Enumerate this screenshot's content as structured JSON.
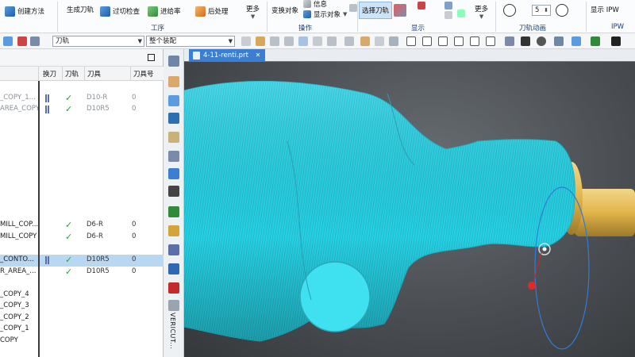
{
  "ribbon": {
    "buttons": {
      "create_method": "创建方法",
      "generate_toolpath": "生成刀轨",
      "gouge_check": "过切检查",
      "toolpath_from": "进给率",
      "post_process": "后处理",
      "transform_object": "变换对象",
      "info": "信息",
      "display_object": "显示对象",
      "select_toolpath": "选择刀轨",
      "display_ipw": "显示 IPW"
    },
    "more_label": "更多",
    "groups": {
      "process": "工序",
      "operation": "操作",
      "display": "显示",
      "toolpath_animation": "刀轨动画",
      "ipw": "IPW"
    },
    "animation_speed": "5"
  },
  "toolbar2": {
    "filter_combo": "刀轨",
    "assembly_combo": "整个装配"
  },
  "navigator": {
    "columns": {
      "tool_change": "换刀",
      "toolpath": "刀轨",
      "tool": "刀具",
      "tool_number": "刀具号"
    },
    "rows": [
      {
        "name": "",
        "tool": false,
        "check": false,
        "tool_name": "",
        "num": "",
        "dim": false,
        "selected": false
      },
      {
        "name": "_COPY_1...",
        "tool": true,
        "check": true,
        "tool_name": "D10-R",
        "num": "0",
        "dim": true,
        "selected": false
      },
      {
        "name": "AREA_COPY",
        "tool": true,
        "check": true,
        "tool_name": "D10R5",
        "num": "0",
        "dim": true,
        "selected": false
      },
      {
        "name": "",
        "tool": false,
        "check": false,
        "tool_name": "",
        "num": "",
        "dim": false,
        "selected": false
      },
      {
        "name": "",
        "tool": false,
        "check": false,
        "tool_name": "",
        "num": "",
        "dim": false,
        "selected": false
      },
      {
        "name": "",
        "tool": false,
        "check": false,
        "tool_name": "",
        "num": "",
        "dim": false,
        "selected": false
      },
      {
        "name": "",
        "tool": false,
        "check": false,
        "tool_name": "",
        "num": "",
        "dim": false,
        "selected": false
      },
      {
        "name": "",
        "tool": false,
        "check": false,
        "tool_name": "",
        "num": "",
        "dim": false,
        "selected": false
      },
      {
        "name": "",
        "tool": false,
        "check": false,
        "tool_name": "",
        "num": "",
        "dim": false,
        "selected": false
      },
      {
        "name": "",
        "tool": false,
        "check": false,
        "tool_name": "",
        "num": "",
        "dim": false,
        "selected": false
      },
      {
        "name": "",
        "tool": false,
        "check": false,
        "tool_name": "",
        "num": "",
        "dim": false,
        "selected": false
      },
      {
        "name": "",
        "tool": false,
        "check": false,
        "tool_name": "",
        "num": "",
        "dim": false,
        "selected": false
      },
      {
        "name": "MILL_COP...",
        "tool": false,
        "check": true,
        "tool_name": "D6-R",
        "num": "0",
        "dim": false,
        "selected": false
      },
      {
        "name": "MILL_COPY",
        "tool": false,
        "check": true,
        "tool_name": "D6-R",
        "num": "0",
        "dim": false,
        "selected": false
      },
      {
        "name": "",
        "tool": false,
        "check": false,
        "tool_name": "",
        "num": "",
        "dim": false,
        "selected": false
      },
      {
        "name": "_CONTO...",
        "tool": true,
        "check": true,
        "tool_name": "D10R5",
        "num": "0",
        "dim": false,
        "selected": true
      },
      {
        "name": "R_AREA_...",
        "tool": false,
        "check": true,
        "tool_name": "D10R5",
        "num": "0",
        "dim": false,
        "selected": false
      },
      {
        "name": "",
        "tool": false,
        "check": false,
        "tool_name": "",
        "num": "",
        "dim": false,
        "selected": false
      },
      {
        "name": "_COPY_4",
        "tool": false,
        "check": false,
        "tool_name": "",
        "num": "",
        "dim": false,
        "selected": false
      },
      {
        "name": "_COPY_3",
        "tool": false,
        "check": false,
        "tool_name": "",
        "num": "",
        "dim": false,
        "selected": false
      },
      {
        "name": "_COPY_2",
        "tool": false,
        "check": false,
        "tool_name": "",
        "num": "",
        "dim": false,
        "selected": false
      },
      {
        "name": "_COPY_1",
        "tool": false,
        "check": false,
        "tool_name": "",
        "num": "",
        "dim": false,
        "selected": false
      },
      {
        "name": "COPY",
        "tool": false,
        "check": false,
        "tool_name": "",
        "num": "",
        "dim": false,
        "selected": false
      }
    ]
  },
  "resource_bar": {
    "vericut_label": "VERICUT..."
  },
  "tabs": {
    "file_tab": "4-11-renti.prt"
  },
  "colors": {
    "accent": "#3c7fd2",
    "toolpath_cyan": "#1fd6e6",
    "holder_gold": "#e2b44a",
    "viewport_bg": "#4a4e52"
  }
}
